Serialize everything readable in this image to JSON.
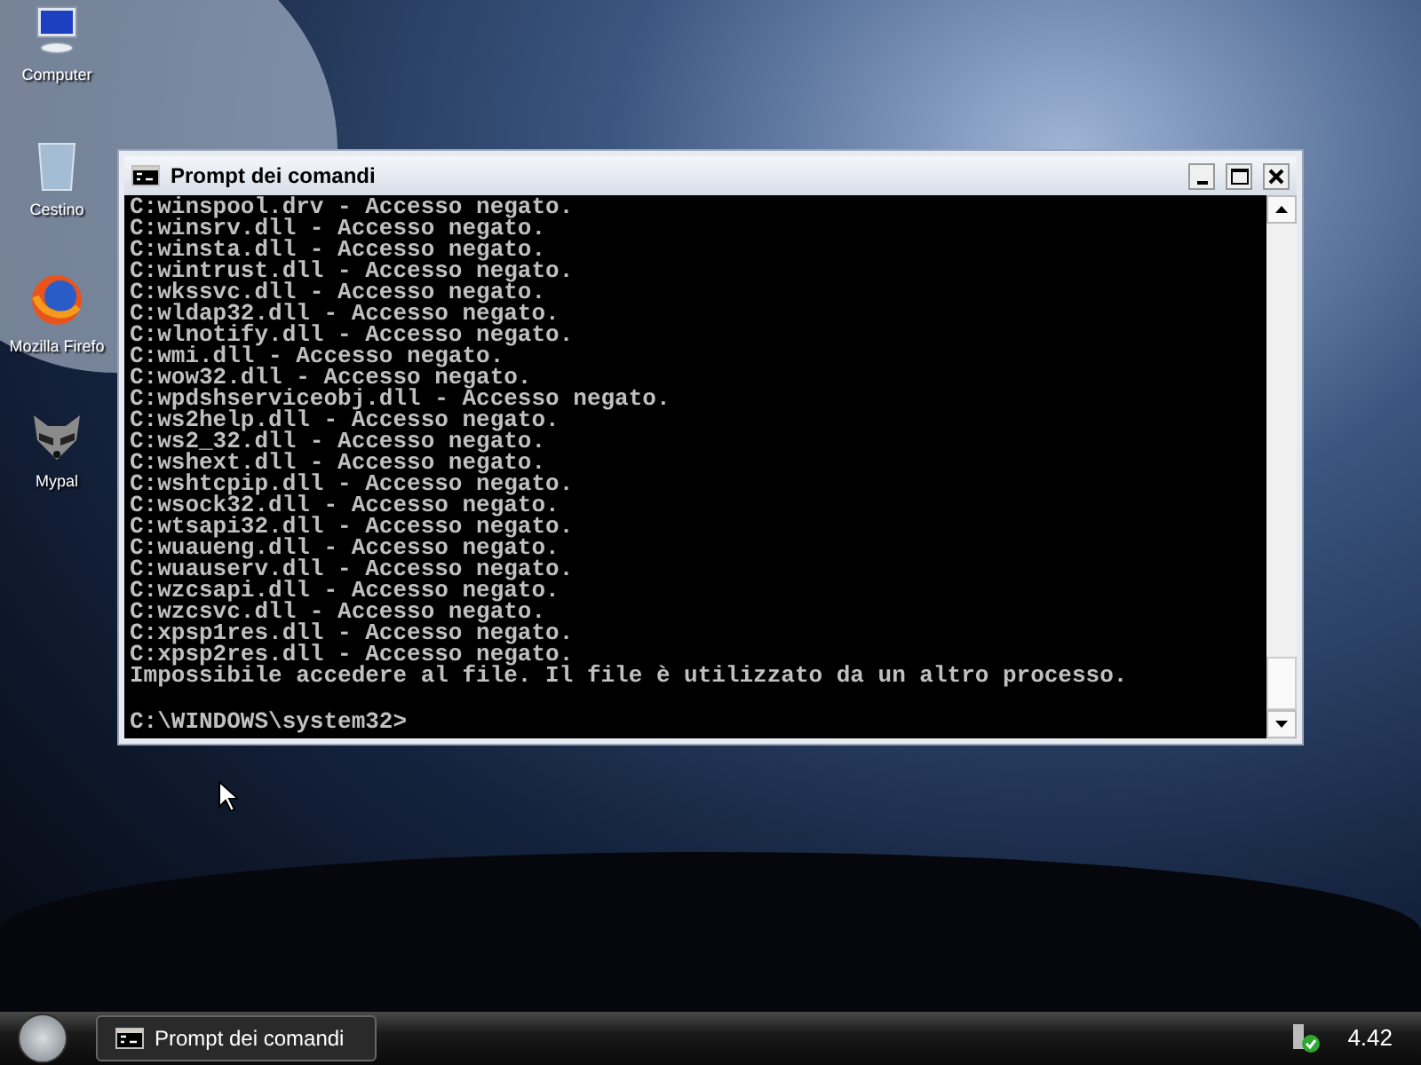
{
  "desktop_icons": [
    {
      "kind": "computer",
      "label": "Computer"
    },
    {
      "kind": "bin",
      "label": "Cestino"
    },
    {
      "kind": "firefox",
      "label": "Mozilla Firefo"
    },
    {
      "kind": "raccoon",
      "label": "Mypal"
    }
  ],
  "window": {
    "title": "Prompt dei comandi",
    "lines": [
      "C:winspool.drv - Accesso negato.",
      "C:winsrv.dll - Accesso negato.",
      "C:winsta.dll - Accesso negato.",
      "C:wintrust.dll - Accesso negato.",
      "C:wkssvc.dll - Accesso negato.",
      "C:wldap32.dll - Accesso negato.",
      "C:wlnotify.dll - Accesso negato.",
      "C:wmi.dll - Accesso negato.",
      "C:wow32.dll - Accesso negato.",
      "C:wpdshserviceobj.dll - Accesso negato.",
      "C:ws2help.dll - Accesso negato.",
      "C:ws2_32.dll - Accesso negato.",
      "C:wshext.dll - Accesso negato.",
      "C:wshtcpip.dll - Accesso negato.",
      "C:wsock32.dll - Accesso negato.",
      "C:wtsapi32.dll - Accesso negato.",
      "C:wuaueng.dll - Accesso negato.",
      "C:wuauserv.dll - Accesso negato.",
      "C:wzcsapi.dll - Accesso negato.",
      "C:wzcsvc.dll - Accesso negato.",
      "C:xpsp1res.dll - Accesso negato.",
      "C:xpsp2res.dll - Accesso negato.",
      "Impossibile accedere al file. Il file è utilizzato da un altro processo."
    ],
    "prompt": "C:\\WINDOWS\\system32>"
  },
  "taskbar": {
    "tasks": [
      {
        "label": "Prompt dei comandi",
        "selected": true
      }
    ],
    "clock": "4.42"
  }
}
